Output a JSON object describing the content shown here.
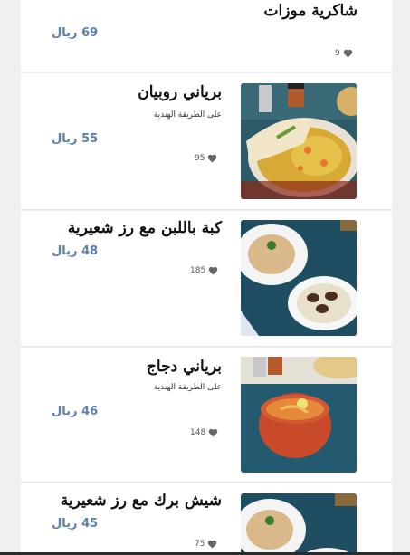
{
  "items": [
    {
      "name": "شاكرية موزات",
      "subtitle": "",
      "price": "69 ريال",
      "likes": "9"
    },
    {
      "name": "برياني روبيان",
      "subtitle": "على الطريقة الهندية",
      "price": "55 ريال",
      "likes": "95"
    },
    {
      "name": "كبة باللبن مع رز شعيرية",
      "subtitle": "",
      "price": "48 ريال",
      "likes": "185"
    },
    {
      "name": "برياني دجاج",
      "subtitle": "على الطريقة الهندية",
      "price": "46 ريال",
      "likes": "148"
    },
    {
      "name": "شيش برك مع رز شعيرية",
      "subtitle": "",
      "price": "45 ريال",
      "likes": "75"
    }
  ],
  "icons": {
    "like": "heart-icon"
  },
  "colors": {
    "price": "#5b7fae",
    "background": "#f0f0f0",
    "card": "#ffffff"
  }
}
